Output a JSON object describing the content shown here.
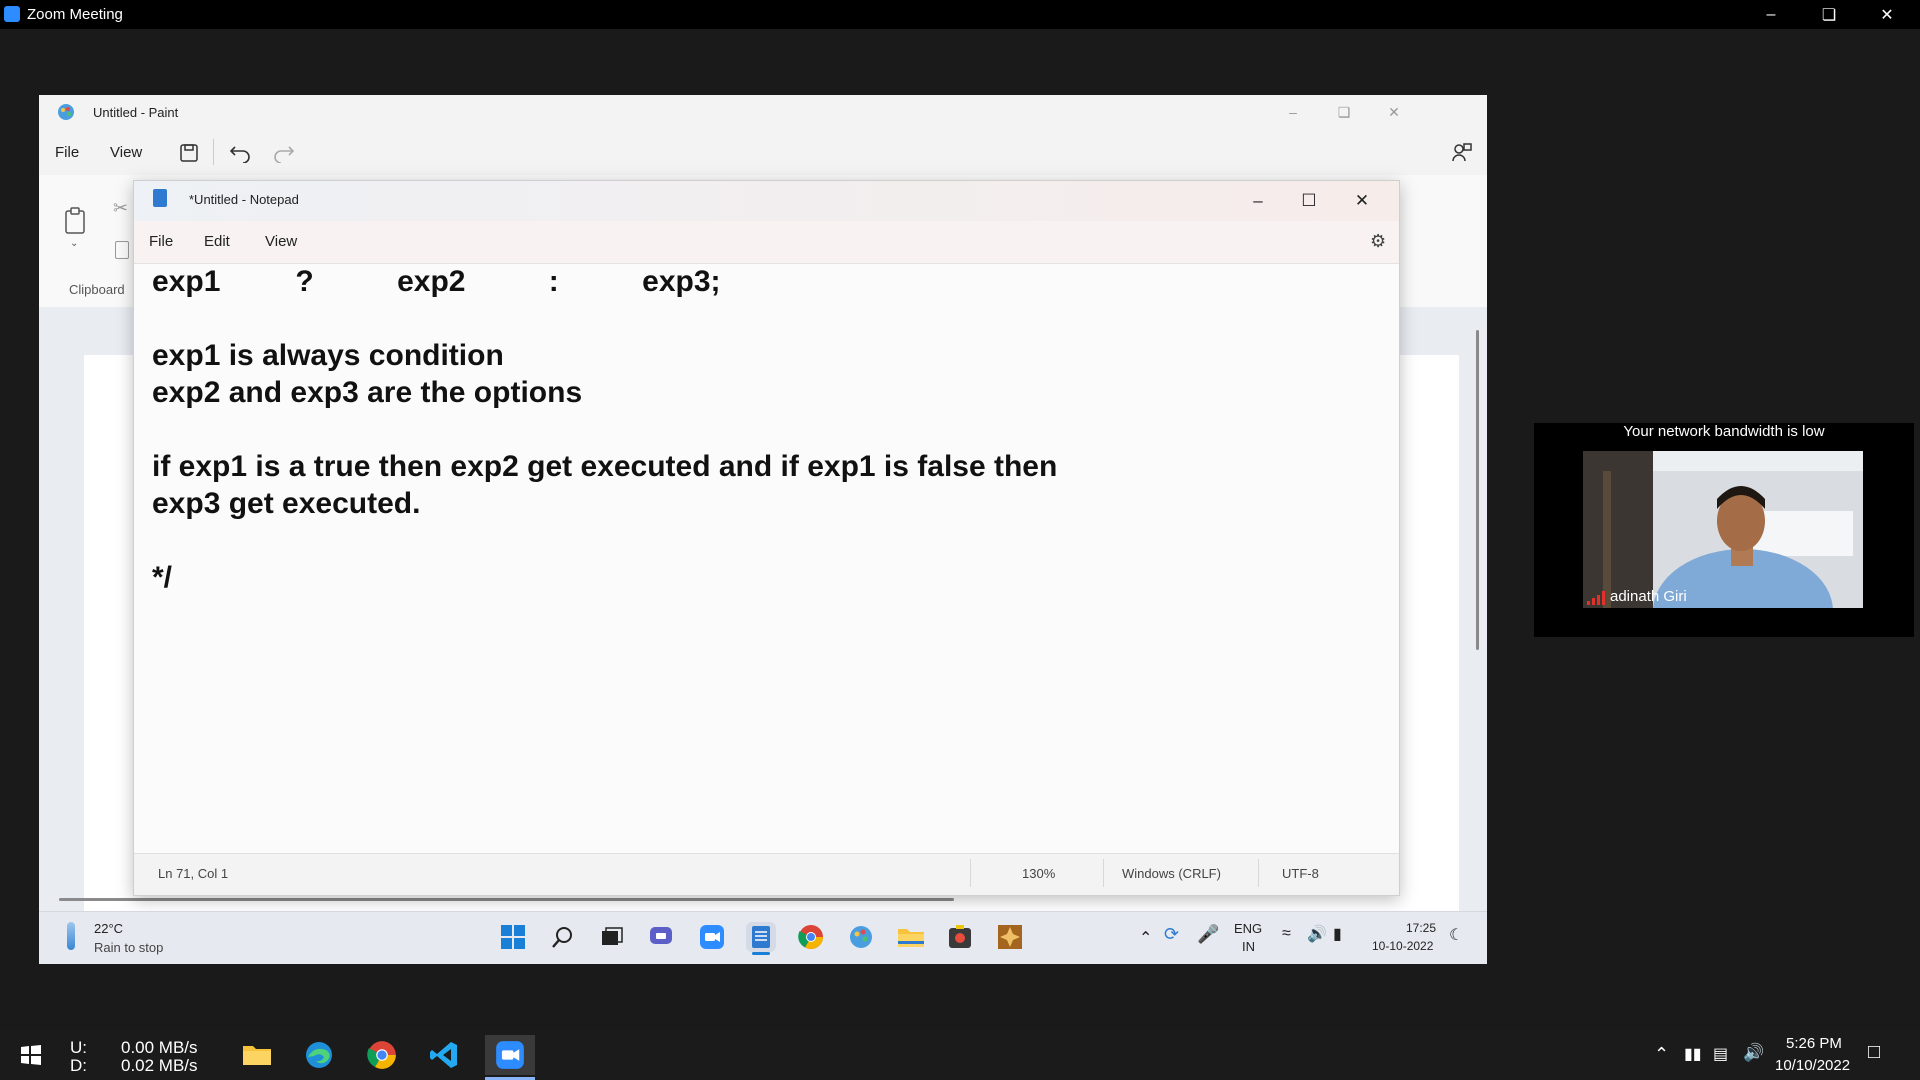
{
  "zoom": {
    "window_title": "Zoom Meeting"
  },
  "paint": {
    "title": "Untitled - Paint",
    "menu": [
      "File",
      "View"
    ],
    "ribbon_group": "Clipboard"
  },
  "notepad": {
    "title": "*Untitled - Notepad",
    "menu": [
      "File",
      "Edit",
      "View"
    ],
    "lines": [
      "exp1         ?          exp2          :          exp3;",
      "",
      "exp1 is always condition",
      "exp2 and exp3 are the options",
      "",
      "if exp1 is a true then exp2 get executed and if exp1 is false then",
      "exp3 get executed.",
      "",
      "*/"
    ],
    "status": {
      "position": "Ln 71, Col 1",
      "zoom": "130%",
      "line_endings": "Windows (CRLF)",
      "encoding": "UTF-8"
    }
  },
  "remote_taskbar": {
    "weather_temp": "22°C",
    "weather_desc": "Rain to stop",
    "lang_line1": "ENG",
    "lang_line2": "IN",
    "time": "17:25",
    "date": "10-10-2022",
    "apps": [
      "start-icon",
      "search-icon",
      "task-view-icon",
      "teams-chat-icon",
      "zoom-icon",
      "notepad-icon",
      "chrome-icon",
      "paint-icon",
      "file-explorer-icon",
      "media-app-icon",
      "app-icon"
    ]
  },
  "video": {
    "warning": "Your network bandwidth is low",
    "participant_name": "adinath Giri"
  },
  "host_taskbar": {
    "net_up_label": "U:",
    "net_down_label": "D:",
    "net_up_value": "0.00 MB/s",
    "net_down_value": "0.02 MB/s",
    "time": "5:26 PM",
    "date": "10/10/2022",
    "apps": [
      "windows-start-icon",
      "file-explorer-icon",
      "edge-icon",
      "chrome-icon",
      "vscode-icon",
      "zoom-icon"
    ]
  },
  "colors": {
    "zoom_blue": "#2D8CFF",
    "video_bg": "#000000",
    "signal_red": "#e0322a"
  }
}
